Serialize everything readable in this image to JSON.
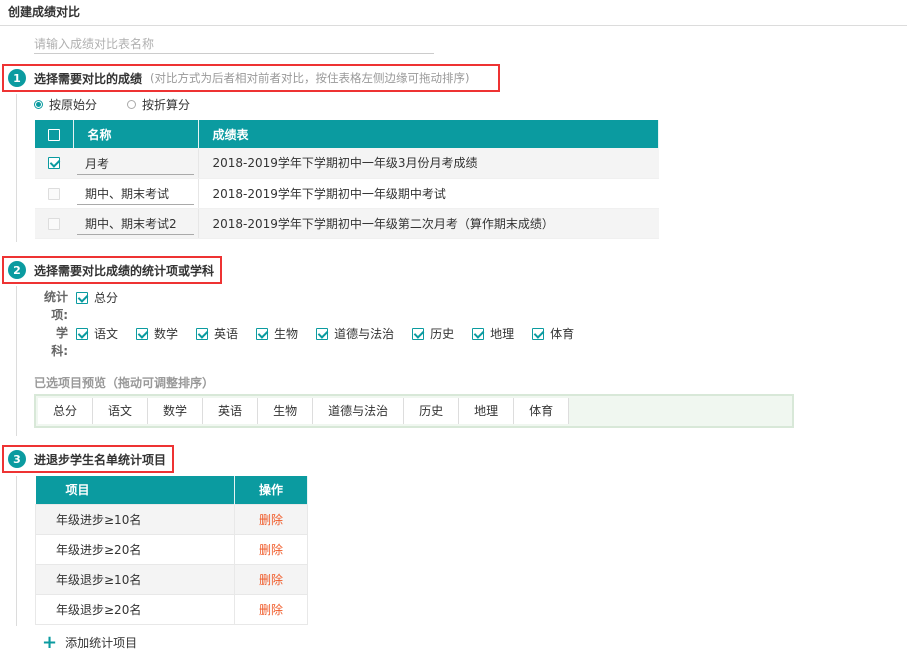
{
  "page_title": "创建成绩对比",
  "name_input": {
    "placeholder": "请输入成绩对比表名称",
    "value": ""
  },
  "step1": {
    "num": "1",
    "title": "选择需要对比的成绩",
    "hint": "(对比方式为后者相对前者对比，按住表格左侧边缘可拖动排序)",
    "radio_original": "按原始分",
    "radio_converted": "按折算分",
    "selected_radio": "按原始分",
    "table": {
      "headers": [
        "名称",
        "成绩表"
      ],
      "rows": [
        {
          "checked": true,
          "name": "月考",
          "sheet": "2018-2019学年下学期初中一年级3月份月考成绩"
        },
        {
          "checked": false,
          "name": "期中、期末考试",
          "sheet": "2018-2019学年下学期初中一年级期中考试"
        },
        {
          "checked": false,
          "name": "期中、期末考试2",
          "sheet": "2018-2019学年下学期初中一年级第二次月考（算作期末成绩）"
        }
      ]
    }
  },
  "step2": {
    "num": "2",
    "title": "选择需要对比成绩的统计项或学科",
    "stat_label": "统计项:",
    "subject_label": "学科:",
    "stat_items": [
      {
        "label": "总分",
        "checked": true
      }
    ],
    "subjects": [
      {
        "label": "语文",
        "checked": true
      },
      {
        "label": "数学",
        "checked": true
      },
      {
        "label": "英语",
        "checked": true
      },
      {
        "label": "生物",
        "checked": true
      },
      {
        "label": "道德与法治",
        "checked": true
      },
      {
        "label": "历史",
        "checked": true
      },
      {
        "label": "地理",
        "checked": true
      },
      {
        "label": "体育",
        "checked": true
      }
    ],
    "preview_title": "已选项目预览（拖动可调整排序）",
    "preview_items": [
      "总分",
      "语文",
      "数学",
      "英语",
      "生物",
      "道德与法治",
      "历史",
      "地理",
      "体育"
    ]
  },
  "step3": {
    "num": "3",
    "title": "进退步学生名单统计项目",
    "table": {
      "headers": [
        "项目",
        "操作"
      ],
      "rows": [
        {
          "item": "年级进步≥10名",
          "action": "删除"
        },
        {
          "item": "年级进步≥20名",
          "action": "删除"
        },
        {
          "item": "年级退步≥10名",
          "action": "删除"
        },
        {
          "item": "年级退步≥20名",
          "action": "删除"
        }
      ]
    },
    "add_label": "添加统计项目"
  },
  "colors": {
    "accent": "#0b9ba0",
    "highlight_border": "#e33",
    "delete": "#f05a28"
  }
}
